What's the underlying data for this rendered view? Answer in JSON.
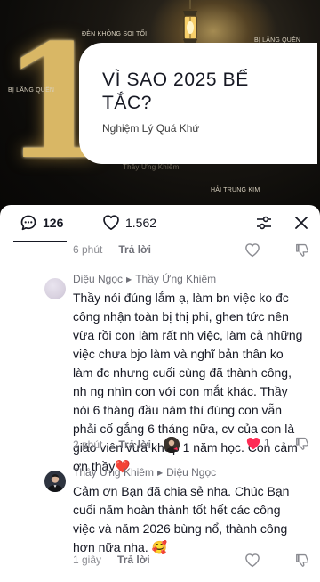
{
  "video": {
    "big_number": "1",
    "overlay_texts": [
      "ĐÈN KHÔNG SOI TỐI",
      "BỊ LÃNG QUÊN",
      "BỊ LÃNG QUÊN",
      "HẢI TRUNG KIM",
      "Thầy Ứng Khiêm"
    ],
    "title": "VÌ SAO 2025 BẾ TẮC?",
    "subtitle": "Nghiệm Lý Quá Khứ"
  },
  "header": {
    "comment_count": "126",
    "like_count": "1.562"
  },
  "top_row": {
    "time": "6 phút",
    "reply_label": "Trả lời"
  },
  "comments": [
    {
      "author": "Diệu Ngọc",
      "reply_to": "Thầy Ứng Khiêm",
      "text": "Thầy nói đúng lắm ạ, làm bn việc ko đc công nhận toàn bị thị phi, ghen tức nên vừa rồi con làm rất nh việc, làm cả những việc chưa bjo làm và nghĩ bản thân ko làm đc nhưng cuối cùng đã thành công, nh ng nhìn con với con mắt khác. Thầy nói 6 tháng đầu năm thì đúng con vẫn phải cố gắng 6 tháng nữa, cv của con là giáo viên vừa khớp 1 năm học. Con cảm ơn thầy",
      "emoji": "❤️",
      "time": "2 phút",
      "reply_label": "Trả lời",
      "likes": "1"
    },
    {
      "author": "Thầy Ứng Khiêm",
      "reply_to": "Diệu Ngọc",
      "text": "Cảm ơn Bạn đã chia sẻ nha. Chúc Bạn cuối năm hoàn thành tốt hết các công việc và năm 2026 bùng nổ, thành công hơn nữa nha.",
      "emoji": "🥰",
      "time": "1 giây",
      "reply_label": "Trả lời"
    }
  ],
  "colors": {
    "accent": "#fe2c55",
    "text_primary": "#161823",
    "text_secondary": "#8a8b91"
  }
}
